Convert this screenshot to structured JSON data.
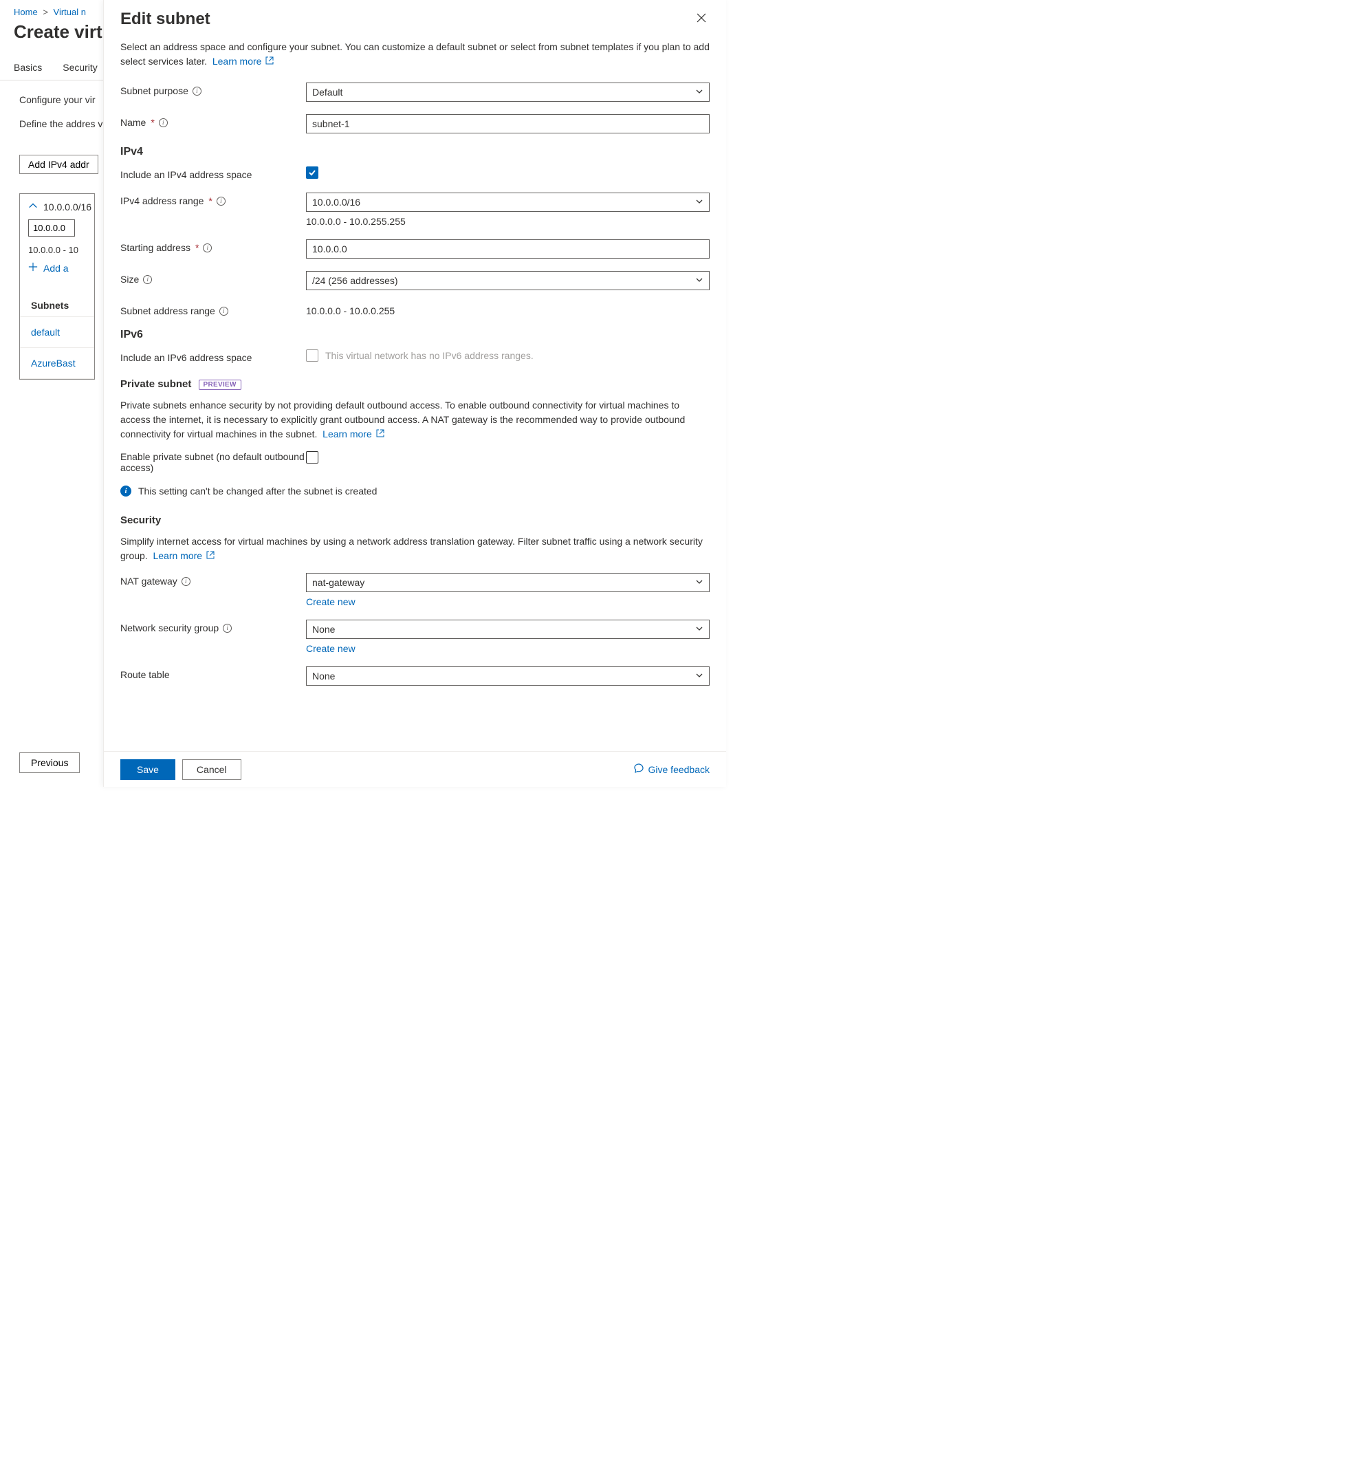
{
  "breadcrumb": {
    "home": "Home",
    "prev": "Virtual n"
  },
  "page": {
    "title": "Create virt",
    "tabs": {
      "basics": "Basics",
      "security": "Security"
    },
    "configure_line": "Configure your vir",
    "define_para": "Define the addres virtual network ad assigns the resou",
    "add_ipv4_btn": "Add IPv4 addr",
    "card": {
      "range": "10.0.0.0/16",
      "start_value": "10.0.0.0",
      "range_expanded": "10.0.0.0 - 10",
      "add_subnet": "Add a"
    },
    "subnets_header": "Subnets",
    "subnet_rows": [
      "default",
      "AzureBast"
    ],
    "prev_btn": "Previous"
  },
  "panel": {
    "title": "Edit subnet",
    "description": "Select an address space and configure your subnet. You can customize a default subnet or select from subnet templates if you plan to add select services later.",
    "learn_more": "Learn more",
    "subnet_purpose": {
      "label": "Subnet purpose",
      "value": "Default"
    },
    "name": {
      "label": "Name",
      "value": "subnet-1"
    },
    "ipv4": {
      "heading": "IPv4",
      "include_label": "Include an IPv4 address space",
      "include_checked": true,
      "address_range_label": "IPv4 address range",
      "address_range_value": "10.0.0.0/16",
      "address_range_hint": "10.0.0.0 - 10.0.255.255",
      "start_label": "Starting address",
      "start_value": "10.0.0.0",
      "size_label": "Size",
      "size_value": "/24 (256 addresses)",
      "subnet_range_label": "Subnet address range",
      "subnet_range_value": "10.0.0.0 - 10.0.0.255"
    },
    "ipv6": {
      "heading": "IPv6",
      "include_label": "Include an IPv6 address space",
      "hint": "This virtual network has no IPv6 address ranges."
    },
    "private": {
      "heading": "Private subnet",
      "badge": "PREVIEW",
      "description": "Private subnets enhance security by not providing default outbound access. To enable outbound connectivity for virtual machines to access the internet, it is necessary to explicitly grant outbound access. A NAT gateway is the recommended way to provide outbound connectivity for virtual machines in the subnet.",
      "enable_label": "Enable private subnet (no default outbound access)",
      "notice": "This setting can't be changed after the subnet is created"
    },
    "security": {
      "heading": "Security",
      "description": "Simplify internet access for virtual machines by using a network address translation gateway. Filter subnet traffic using a network security group.",
      "nat_label": "NAT gateway",
      "nat_value": "nat-gateway",
      "nsg_label": "Network security group",
      "nsg_value": "None",
      "route_label": "Route table",
      "route_value": "None",
      "create_new": "Create new"
    },
    "footer": {
      "save": "Save",
      "cancel": "Cancel",
      "feedback": "Give feedback"
    }
  }
}
